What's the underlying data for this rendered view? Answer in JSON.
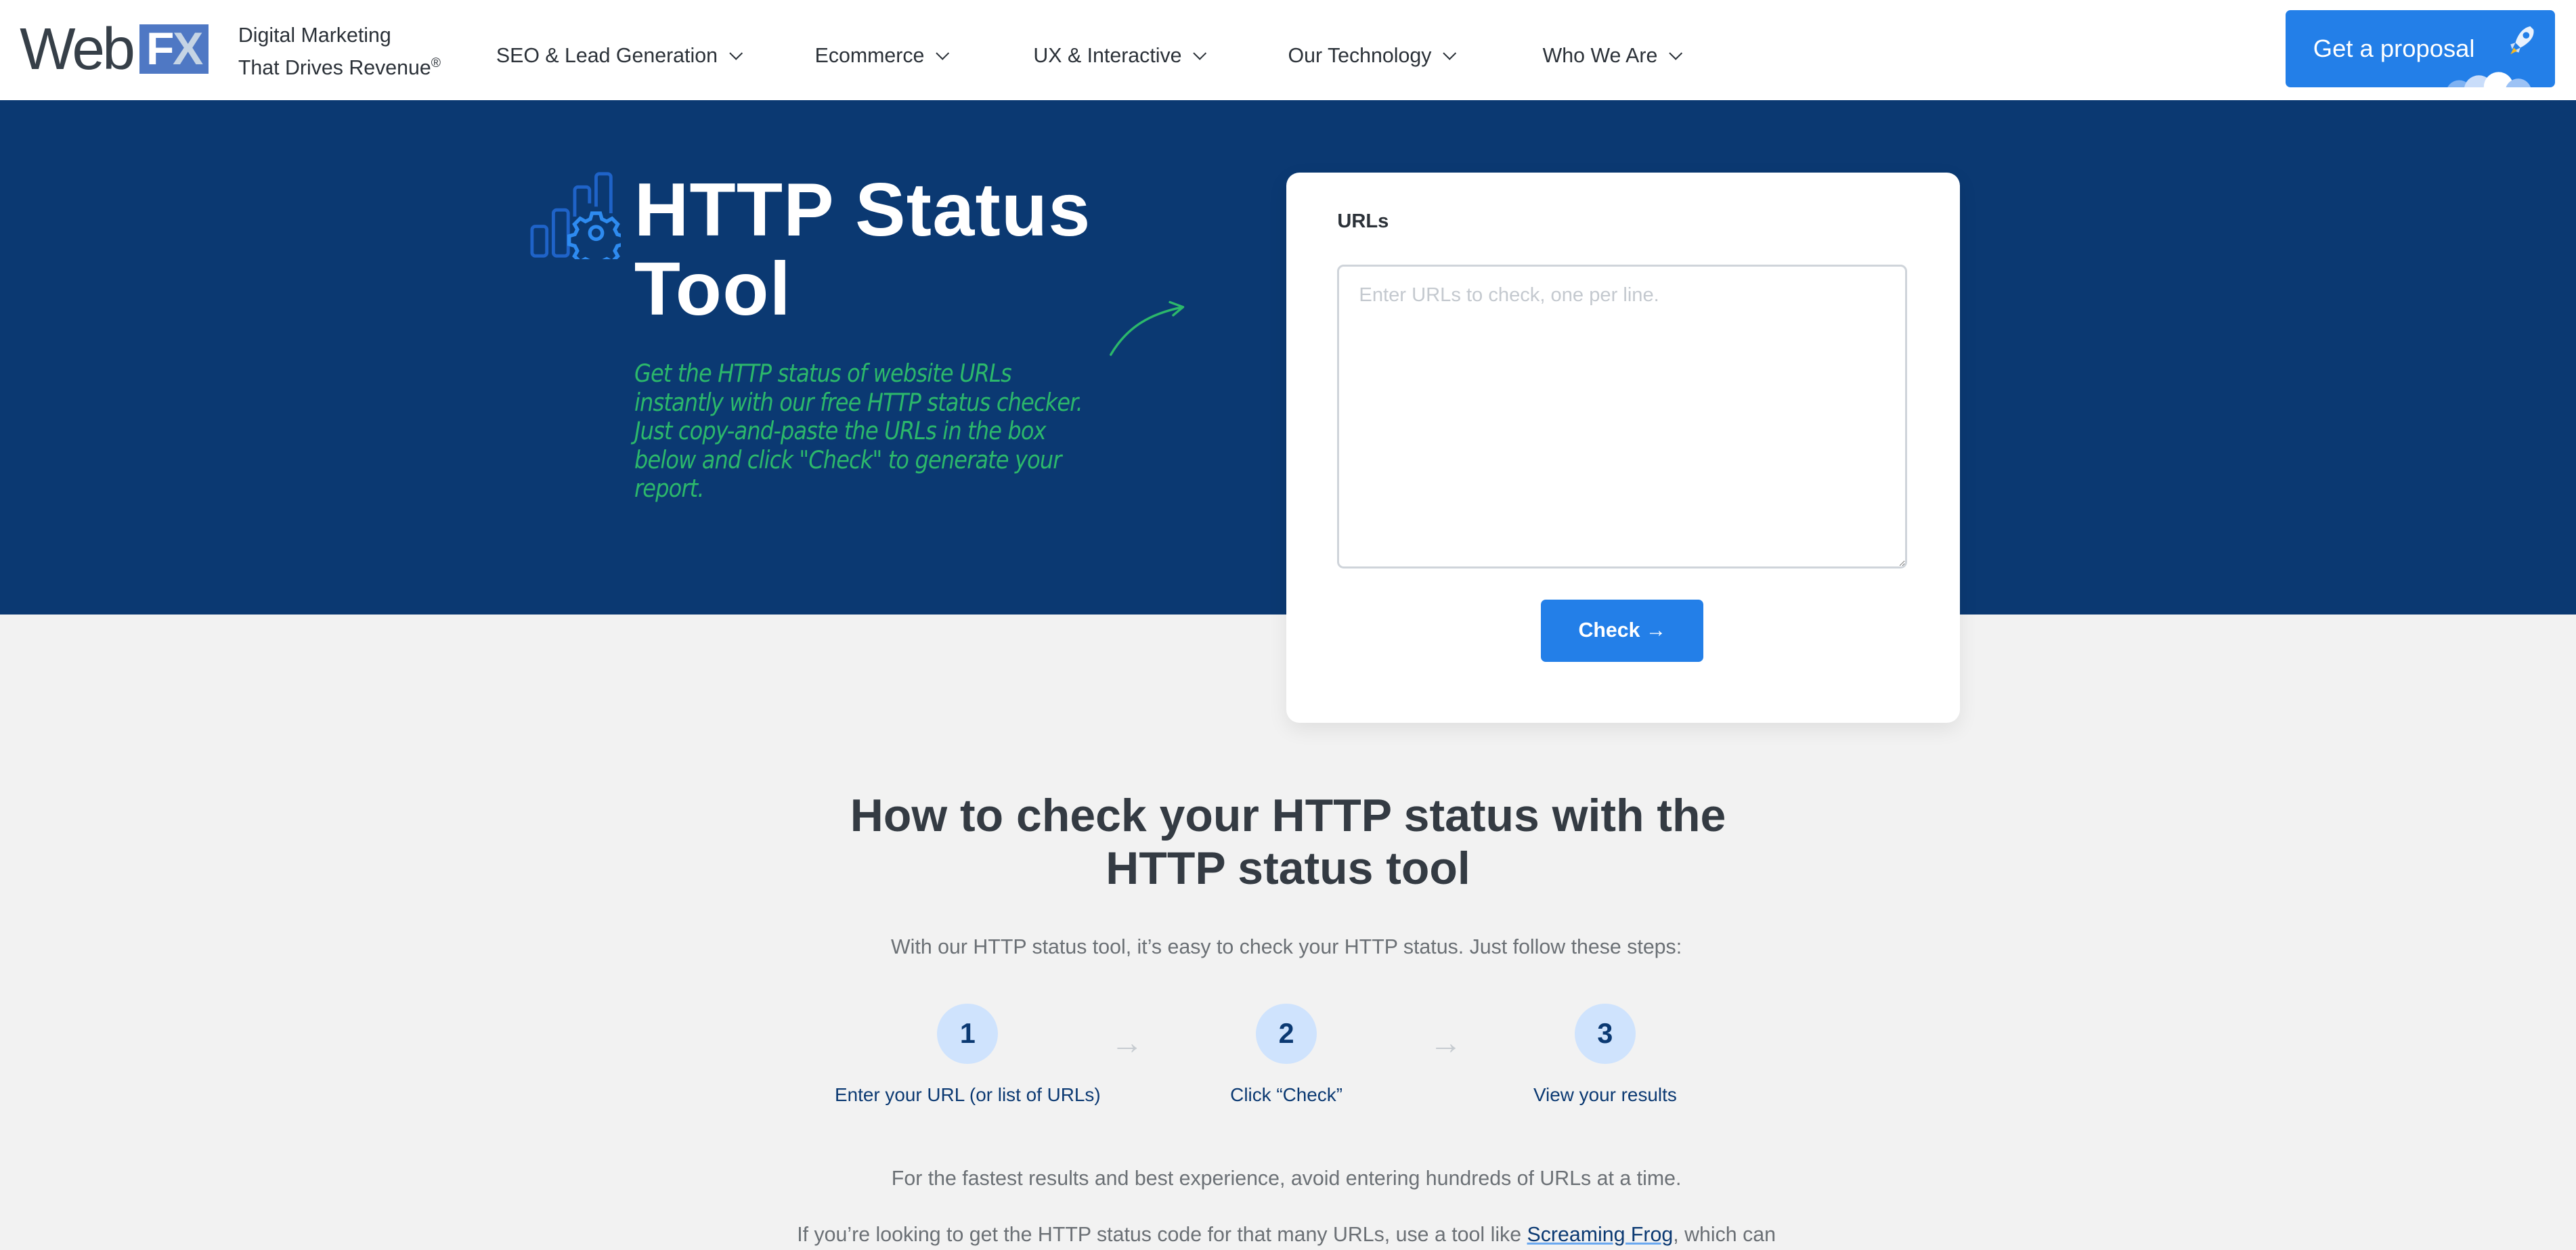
{
  "header": {
    "logo_web": "Web",
    "logo_f": "F",
    "logo_x": "X",
    "tagline_line1": "Digital Marketing",
    "tagline_line2": "That Drives Revenue",
    "tagline_mark": "®",
    "nav": [
      {
        "label": "SEO & Lead Generation"
      },
      {
        "label": "Ecommerce"
      },
      {
        "label": "UX & Interactive"
      },
      {
        "label": "Our Technology"
      },
      {
        "label": "Who We Are"
      }
    ],
    "cta_label": "Get a proposal"
  },
  "hero": {
    "title_line1": "HTTP Status",
    "title_line2": "Tool",
    "description": "Get the HTTP status of website URLs instantly with our free HTTP status checker. Just copy-and-paste the URLs in the box below and click \"Check\" to generate your report."
  },
  "form": {
    "label": "URLs",
    "placeholder": "Enter URLs to check, one per line.",
    "value": "",
    "button_label": "Check →"
  },
  "howto": {
    "title": "How to check your HTTP status with the HTTP status tool",
    "intro": "With our HTTP status tool, it’s easy to check your HTTP status. Just follow these steps:",
    "steps": [
      {
        "number": "1",
        "label": "Enter your URL (or list of URLs)"
      },
      {
        "number": "2",
        "label": "Click “Check”"
      },
      {
        "number": "3",
        "label": "View your results"
      }
    ],
    "step_arrow": "→",
    "note1": "For the fastest results and best experience, avoid entering hundreds of URLs at a time.",
    "note2_before": "If you’re looking to get the HTTP status code for that many URLs, use a tool like ",
    "note2_link": "Screaming Frog",
    "note2_after": ", which can"
  },
  "colors": {
    "brand_navy": "#0b3972",
    "accent_blue": "#237fe8",
    "accent_green": "#2cb86b",
    "step_circle": "#cfe3fd"
  }
}
